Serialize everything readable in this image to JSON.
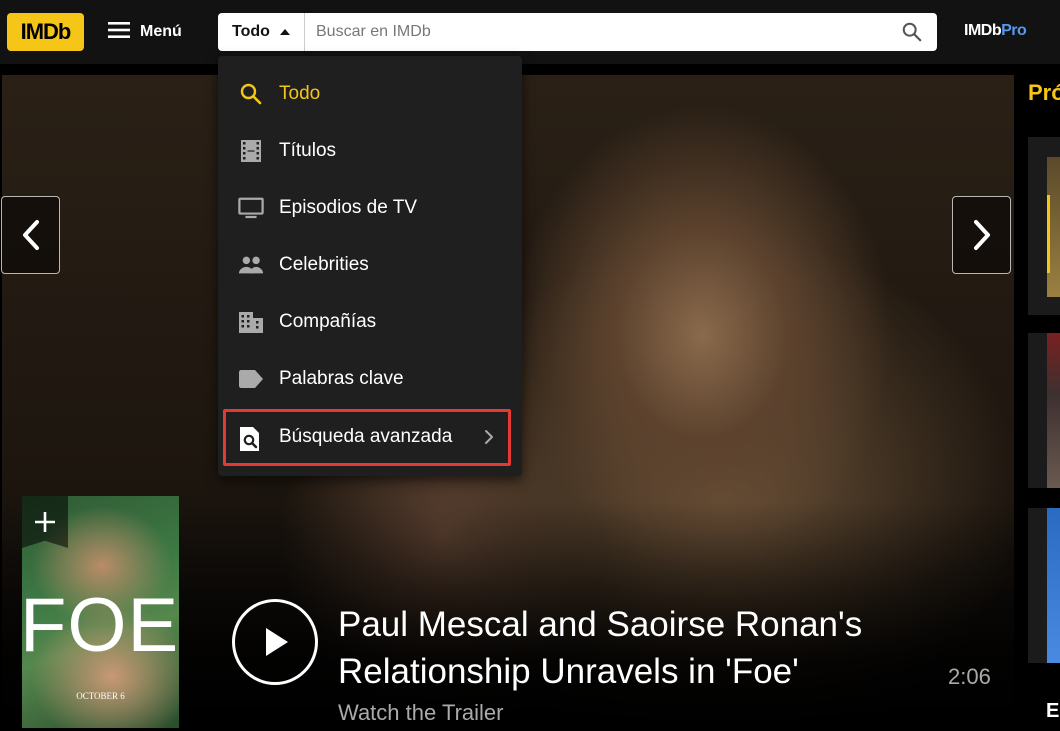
{
  "header": {
    "logo": "IMDb",
    "menu_label": "Menú",
    "search": {
      "scope": "Todo",
      "placeholder": "Buscar en IMDb"
    },
    "pro_logo": {
      "part1": "IMDb",
      "part2": "Pro"
    }
  },
  "dropdown": {
    "items": [
      {
        "label": "Todo",
        "icon": "search-icon",
        "active": true
      },
      {
        "label": "Títulos",
        "icon": "film-icon"
      },
      {
        "label": "Episodios de TV",
        "icon": "tv-icon"
      },
      {
        "label": "Celebrities",
        "icon": "people-icon"
      },
      {
        "label": "Compañías",
        "icon": "building-icon"
      },
      {
        "label": "Palabras clave",
        "icon": "tag-icon"
      }
    ],
    "advanced": {
      "label": "Búsqueda avanzada",
      "icon": "advanced-search-icon",
      "highlight_color": "#e53935"
    }
  },
  "hero": {
    "poster_title": "FOE",
    "poster_date": "OCTOBER 6",
    "caption_title": "Paul Mescal and Saoirse Ronan's Relationship Unravels in 'Foe'",
    "caption_subtitle": "Watch the Trailer",
    "duration": "2:06"
  },
  "rail": {
    "title": "Pró",
    "more": "E"
  },
  "colors": {
    "brand": "#f5c518",
    "header_bg": "#121212",
    "dropdown_bg": "#1f1f1f",
    "pro_accent": "#5799ef"
  }
}
